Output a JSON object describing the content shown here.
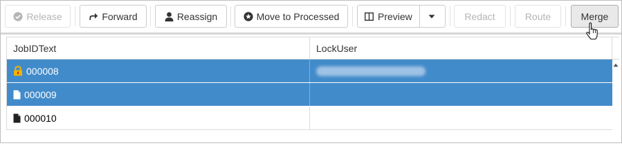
{
  "toolbar": {
    "release": "Release",
    "forward": "Forward",
    "reassign": "Reassign",
    "move_to_processed": "Move to Processed",
    "preview": "Preview",
    "redact": "Redact",
    "route": "Route",
    "merge": "Merge"
  },
  "grid": {
    "columns": [
      "JobIDText",
      "LockUser"
    ],
    "rows": [
      {
        "job_id": "000008",
        "lock_user": "",
        "selected": true,
        "icon": "lock-icon"
      },
      {
        "job_id": "000009",
        "lock_user": "",
        "selected": true,
        "icon": "document-icon"
      },
      {
        "job_id": "000010",
        "lock_user": "",
        "selected": false,
        "icon": "document-icon"
      }
    ]
  },
  "colors": {
    "selection": "#428bca",
    "lock_icon": "#f0b400",
    "lock_badge": "#d9261c"
  }
}
